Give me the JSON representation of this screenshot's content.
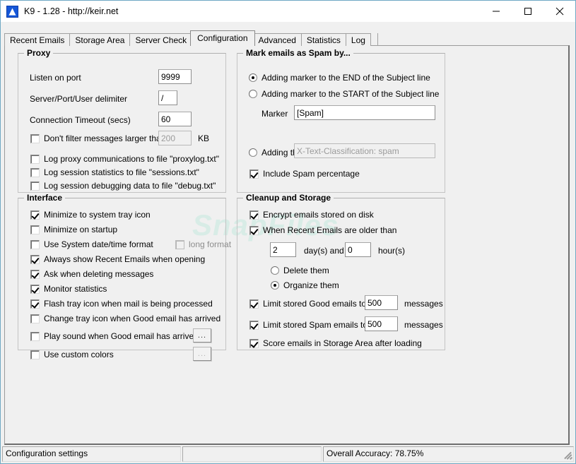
{
  "window": {
    "title": "K9 - 1.28 - http://keir.net",
    "icon": "k9-app-icon",
    "minimize_label": "Minimize",
    "maximize_label": "Maximize",
    "close_label": "Close"
  },
  "watermark": "SnapFiles",
  "tabs": [
    {
      "label": "Recent Emails",
      "active": false
    },
    {
      "label": "Storage Area",
      "active": false
    },
    {
      "label": "Server Check",
      "active": false
    },
    {
      "label": "Configuration",
      "active": true
    },
    {
      "label": "Advanced",
      "active": false
    },
    {
      "label": "Statistics",
      "active": false
    },
    {
      "label": "Log",
      "active": false
    }
  ],
  "proxy": {
    "legend": "Proxy",
    "listen_port_label": "Listen on port",
    "listen_port_value": "9999",
    "delimiter_label": "Server/Port/User delimiter",
    "delimiter_value": "/",
    "timeout_label": "Connection Timeout (secs)",
    "timeout_value": "60",
    "size_filter_label": "Don't filter messages larger than",
    "size_filter_checked": false,
    "size_filter_value": "200",
    "size_filter_unit": "KB",
    "log_proxy_label": "Log proxy communications to file \"proxylog.txt\"",
    "log_proxy_checked": false,
    "log_stats_label": "Log session statistics to file \"sessions.txt\"",
    "log_stats_checked": false,
    "log_debug_label": "Log session debugging data to file \"debug.txt\"",
    "log_debug_checked": false
  },
  "interface": {
    "legend": "Interface",
    "items": [
      {
        "label": "Minimize to system tray icon",
        "checked": true
      },
      {
        "label": "Minimize on startup",
        "checked": false
      },
      {
        "label": "Use System date/time format",
        "checked": false
      },
      {
        "label": "Always show Recent Emails when opening",
        "checked": true
      },
      {
        "label": "Ask when deleting messages",
        "checked": true
      },
      {
        "label": "Monitor statistics",
        "checked": true
      },
      {
        "label": "Flash tray icon when mail is being processed",
        "checked": true
      },
      {
        "label": "Change tray icon when Good email has arrived",
        "checked": false
      },
      {
        "label": "Play sound when Good email has arrived",
        "checked": false
      },
      {
        "label": "Use custom colors",
        "checked": false
      }
    ],
    "long_format_label": "long format",
    "long_format_checked": false,
    "long_format_disabled": true,
    "sound_browse_label": "...",
    "colors_browse_label": "..."
  },
  "spam": {
    "legend": "Mark emails as Spam by...",
    "option_end_label": "Adding marker to the END of the Subject line",
    "option_start_label": "Adding marker to the START of the Subject line",
    "option_header_label": "Adding the following email header line",
    "selected_option": "end",
    "marker_label": "Marker",
    "marker_value": "[Spam]",
    "header_value": "X-Text-Classification: spam",
    "include_percentage_label": "Include Spam percentage",
    "include_percentage_checked": true
  },
  "cleanup": {
    "legend": "Cleanup and Storage",
    "encrypt_label": "Encrypt emails stored on disk",
    "encrypt_checked": true,
    "older_than_label": "When Recent Emails are older than",
    "older_than_checked": true,
    "days_value": "2",
    "days_label": "day(s) and",
    "hours_value": "0",
    "hours_label": "hour(s)",
    "delete_label": "Delete them",
    "organize_label": "Organize them",
    "selected_action": "organize",
    "limit_good_label": "Limit stored Good emails to",
    "limit_good_checked": true,
    "limit_good_value": "500",
    "limit_good_unit": "messages",
    "limit_spam_label": "Limit stored Spam emails to",
    "limit_spam_checked": true,
    "limit_spam_value": "500",
    "limit_spam_unit": "messages",
    "score_label": "Score emails in Storage Area after loading",
    "score_checked": true
  },
  "statusbar": {
    "left": "Configuration settings",
    "middle": "",
    "right": "Overall Accuracy: 78.75%"
  }
}
